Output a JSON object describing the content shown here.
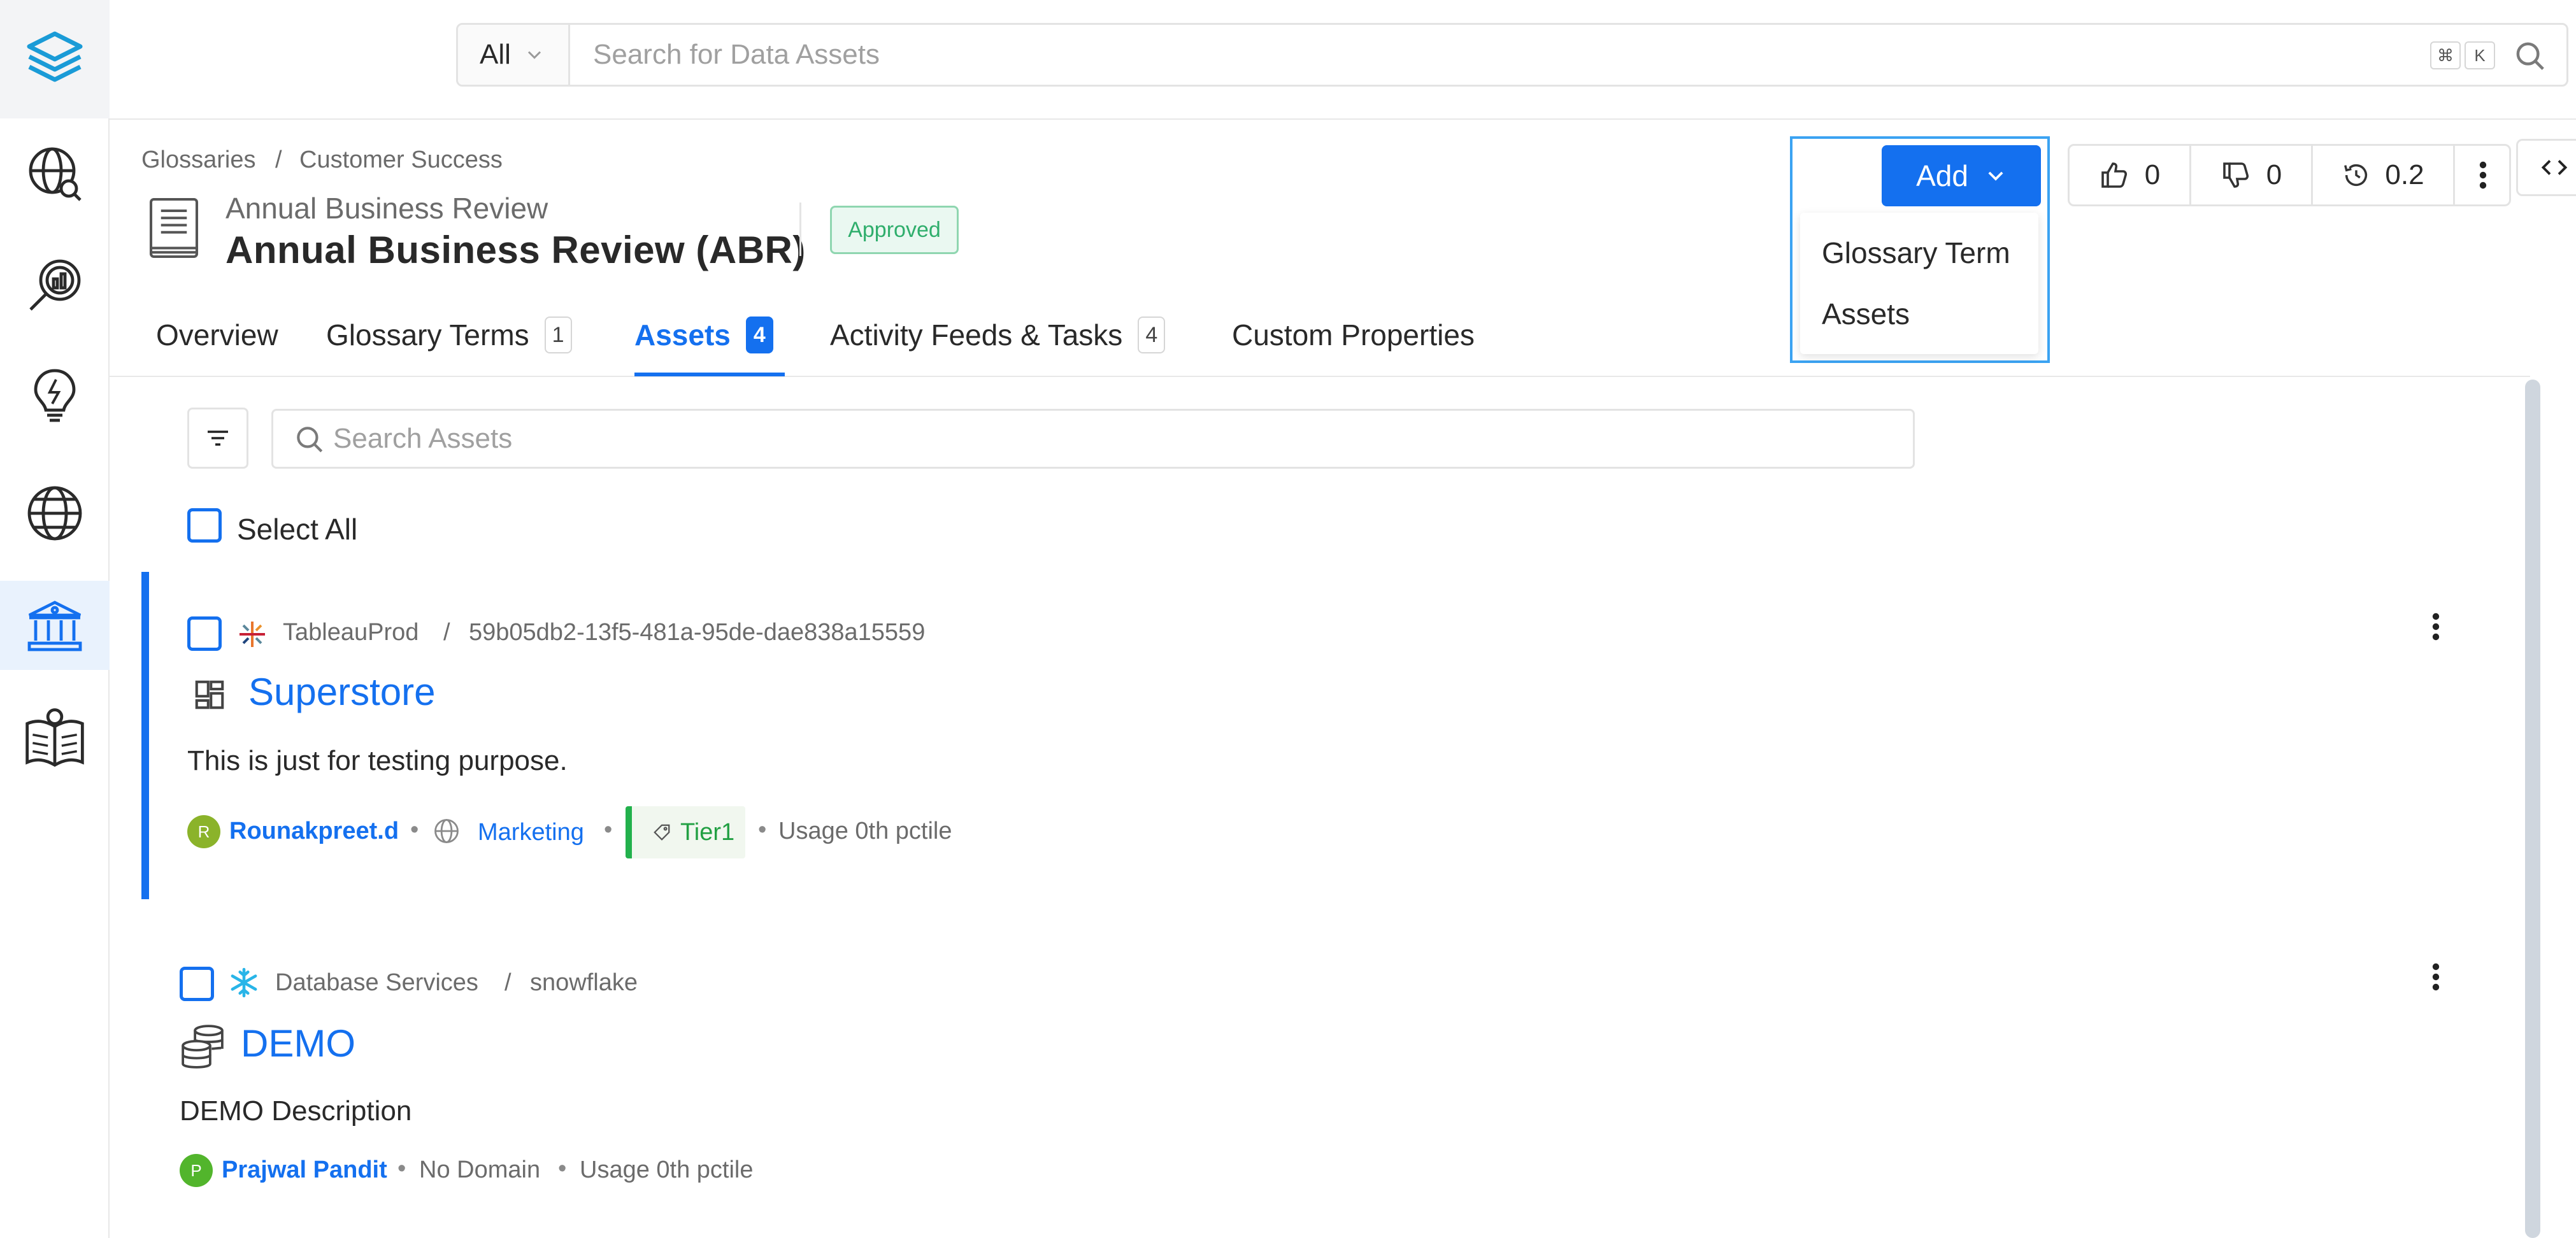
{
  "search": {
    "scope": "All",
    "placeholder": "Search for Data Assets",
    "shortcut_cmd": "⌘",
    "shortcut_key": "K"
  },
  "breadcrumb": {
    "items": [
      "Glossaries",
      "Customer Success"
    ],
    "separator": "/"
  },
  "entity": {
    "subtitle": "Annual Business Review",
    "title": "Annual Business Review (ABR)",
    "status": "Approved"
  },
  "tabs": [
    {
      "label": "Overview",
      "count": ""
    },
    {
      "label": "Glossary Terms",
      "count": "1"
    },
    {
      "label": "Assets",
      "count": "4"
    },
    {
      "label": "Activity Feeds & Tasks",
      "count": "4"
    },
    {
      "label": "Custom Properties",
      "count": ""
    }
  ],
  "add_menu": {
    "button_label": "Add",
    "items": [
      "Glossary Term",
      "Assets"
    ]
  },
  "votes": {
    "up": "0",
    "down": "0",
    "version": "0.2"
  },
  "assets_panel": {
    "search_placeholder": "Search Assets",
    "select_all": "Select All"
  },
  "assets": [
    {
      "service": "TableauProd",
      "path": "59b05db2-13f5-481a-95de-dae838a15559",
      "name": "Superstore",
      "description": "This is just for testing purpose.",
      "owner_initial": "R",
      "owner": "Rounakpreet.d",
      "domain": "Marketing",
      "tier": "Tier1",
      "usage": "Usage 0th pctile"
    },
    {
      "service": "Database Services",
      "path": "snowflake",
      "name": "DEMO",
      "description": "DEMO Description",
      "owner_initial": "P",
      "owner": "Prajwal Pandit",
      "domain": "No Domain",
      "usage": "Usage 0th pctile"
    }
  ],
  "colors": {
    "accent": "#1470ef",
    "approved": "#2fae6c",
    "tier": "#22b14c"
  }
}
